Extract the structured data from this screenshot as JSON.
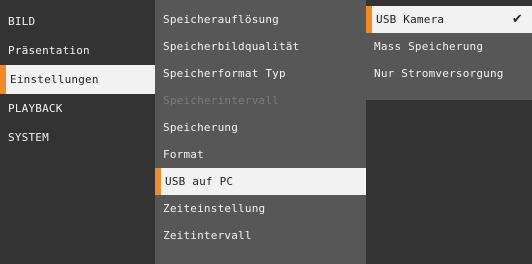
{
  "menu_level1": [
    {
      "label": "BILD",
      "state": "normal"
    },
    {
      "label": "Präsentation",
      "state": "normal"
    },
    {
      "label": "Einstellungen",
      "state": "selected"
    },
    {
      "label": "PLAYBACK",
      "state": "normal"
    },
    {
      "label": "SYSTEM",
      "state": "normal"
    }
  ],
  "menu_level2": [
    {
      "label": "Speicherauflösung",
      "state": "normal"
    },
    {
      "label": "Speicherbildqualität",
      "state": "normal"
    },
    {
      "label": "Speicherformat Typ",
      "state": "normal"
    },
    {
      "label": "Speicherintervall",
      "state": "disabled"
    },
    {
      "label": "Speicherung",
      "state": "normal"
    },
    {
      "label": "Format",
      "state": "normal"
    },
    {
      "label": "USB auf PC",
      "state": "selected"
    },
    {
      "label": "Zeiteinstellung",
      "state": "normal"
    },
    {
      "label": "Zeitintervall",
      "state": "normal"
    }
  ],
  "menu_level3": [
    {
      "label": "USB Kamera",
      "state": "selected",
      "checked": true
    },
    {
      "label": "Mass Speicherung",
      "state": "normal",
      "checked": false
    },
    {
      "label": "Nur Stromversorgung",
      "state": "normal",
      "checked": false
    }
  ],
  "icons": {
    "check": "checkmark-icon"
  },
  "colors": {
    "accent": "#f08a2a",
    "panel_dark": "#333333",
    "panel_mid": "#575757",
    "selected_bg": "#f2f2f2"
  }
}
